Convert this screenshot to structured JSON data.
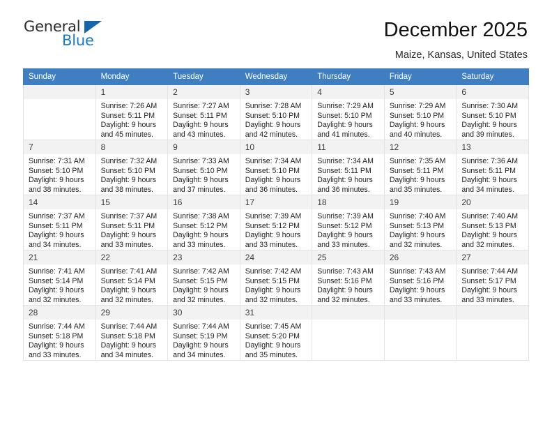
{
  "brand": {
    "name_part1": "General",
    "name_part2": "Blue",
    "triangle_color": "#1565ab",
    "blue_color": "#1878c8"
  },
  "header": {
    "title": "December 2025",
    "subtitle": "Maize, Kansas, United States"
  },
  "theme": {
    "header_row_bg": "#3f7fc1",
    "header_row_text": "#ffffff",
    "daynum_bg": "#f2f2f2",
    "cell_border": "#e3e3e3"
  },
  "weekdays": [
    "Sunday",
    "Monday",
    "Tuesday",
    "Wednesday",
    "Thursday",
    "Friday",
    "Saturday"
  ],
  "weeks": [
    [
      {
        "day": "",
        "empty": true,
        "sunrise": "",
        "sunset": "",
        "daylight_line1": "",
        "daylight_line2": ""
      },
      {
        "day": "1",
        "sunrise": "Sunrise: 7:26 AM",
        "sunset": "Sunset: 5:11 PM",
        "daylight_line1": "Daylight: 9 hours",
        "daylight_line2": "and 45 minutes."
      },
      {
        "day": "2",
        "sunrise": "Sunrise: 7:27 AM",
        "sunset": "Sunset: 5:11 PM",
        "daylight_line1": "Daylight: 9 hours",
        "daylight_line2": "and 43 minutes."
      },
      {
        "day": "3",
        "sunrise": "Sunrise: 7:28 AM",
        "sunset": "Sunset: 5:10 PM",
        "daylight_line1": "Daylight: 9 hours",
        "daylight_line2": "and 42 minutes."
      },
      {
        "day": "4",
        "sunrise": "Sunrise: 7:29 AM",
        "sunset": "Sunset: 5:10 PM",
        "daylight_line1": "Daylight: 9 hours",
        "daylight_line2": "and 41 minutes."
      },
      {
        "day": "5",
        "sunrise": "Sunrise: 7:29 AM",
        "sunset": "Sunset: 5:10 PM",
        "daylight_line1": "Daylight: 9 hours",
        "daylight_line2": "and 40 minutes."
      },
      {
        "day": "6",
        "sunrise": "Sunrise: 7:30 AM",
        "sunset": "Sunset: 5:10 PM",
        "daylight_line1": "Daylight: 9 hours",
        "daylight_line2": "and 39 minutes."
      }
    ],
    [
      {
        "day": "7",
        "sunrise": "Sunrise: 7:31 AM",
        "sunset": "Sunset: 5:10 PM",
        "daylight_line1": "Daylight: 9 hours",
        "daylight_line2": "and 38 minutes."
      },
      {
        "day": "8",
        "sunrise": "Sunrise: 7:32 AM",
        "sunset": "Sunset: 5:10 PM",
        "daylight_line1": "Daylight: 9 hours",
        "daylight_line2": "and 38 minutes."
      },
      {
        "day": "9",
        "sunrise": "Sunrise: 7:33 AM",
        "sunset": "Sunset: 5:10 PM",
        "daylight_line1": "Daylight: 9 hours",
        "daylight_line2": "and 37 minutes."
      },
      {
        "day": "10",
        "sunrise": "Sunrise: 7:34 AM",
        "sunset": "Sunset: 5:10 PM",
        "daylight_line1": "Daylight: 9 hours",
        "daylight_line2": "and 36 minutes."
      },
      {
        "day": "11",
        "sunrise": "Sunrise: 7:34 AM",
        "sunset": "Sunset: 5:11 PM",
        "daylight_line1": "Daylight: 9 hours",
        "daylight_line2": "and 36 minutes."
      },
      {
        "day": "12",
        "sunrise": "Sunrise: 7:35 AM",
        "sunset": "Sunset: 5:11 PM",
        "daylight_line1": "Daylight: 9 hours",
        "daylight_line2": "and 35 minutes."
      },
      {
        "day": "13",
        "sunrise": "Sunrise: 7:36 AM",
        "sunset": "Sunset: 5:11 PM",
        "daylight_line1": "Daylight: 9 hours",
        "daylight_line2": "and 34 minutes."
      }
    ],
    [
      {
        "day": "14",
        "sunrise": "Sunrise: 7:37 AM",
        "sunset": "Sunset: 5:11 PM",
        "daylight_line1": "Daylight: 9 hours",
        "daylight_line2": "and 34 minutes."
      },
      {
        "day": "15",
        "sunrise": "Sunrise: 7:37 AM",
        "sunset": "Sunset: 5:11 PM",
        "daylight_line1": "Daylight: 9 hours",
        "daylight_line2": "and 33 minutes."
      },
      {
        "day": "16",
        "sunrise": "Sunrise: 7:38 AM",
        "sunset": "Sunset: 5:12 PM",
        "daylight_line1": "Daylight: 9 hours",
        "daylight_line2": "and 33 minutes."
      },
      {
        "day": "17",
        "sunrise": "Sunrise: 7:39 AM",
        "sunset": "Sunset: 5:12 PM",
        "daylight_line1": "Daylight: 9 hours",
        "daylight_line2": "and 33 minutes."
      },
      {
        "day": "18",
        "sunrise": "Sunrise: 7:39 AM",
        "sunset": "Sunset: 5:12 PM",
        "daylight_line1": "Daylight: 9 hours",
        "daylight_line2": "and 33 minutes."
      },
      {
        "day": "19",
        "sunrise": "Sunrise: 7:40 AM",
        "sunset": "Sunset: 5:13 PM",
        "daylight_line1": "Daylight: 9 hours",
        "daylight_line2": "and 32 minutes."
      },
      {
        "day": "20",
        "sunrise": "Sunrise: 7:40 AM",
        "sunset": "Sunset: 5:13 PM",
        "daylight_line1": "Daylight: 9 hours",
        "daylight_line2": "and 32 minutes."
      }
    ],
    [
      {
        "day": "21",
        "sunrise": "Sunrise: 7:41 AM",
        "sunset": "Sunset: 5:14 PM",
        "daylight_line1": "Daylight: 9 hours",
        "daylight_line2": "and 32 minutes."
      },
      {
        "day": "22",
        "sunrise": "Sunrise: 7:41 AM",
        "sunset": "Sunset: 5:14 PM",
        "daylight_line1": "Daylight: 9 hours",
        "daylight_line2": "and 32 minutes."
      },
      {
        "day": "23",
        "sunrise": "Sunrise: 7:42 AM",
        "sunset": "Sunset: 5:15 PM",
        "daylight_line1": "Daylight: 9 hours",
        "daylight_line2": "and 32 minutes."
      },
      {
        "day": "24",
        "sunrise": "Sunrise: 7:42 AM",
        "sunset": "Sunset: 5:15 PM",
        "daylight_line1": "Daylight: 9 hours",
        "daylight_line2": "and 32 minutes."
      },
      {
        "day": "25",
        "sunrise": "Sunrise: 7:43 AM",
        "sunset": "Sunset: 5:16 PM",
        "daylight_line1": "Daylight: 9 hours",
        "daylight_line2": "and 32 minutes."
      },
      {
        "day": "26",
        "sunrise": "Sunrise: 7:43 AM",
        "sunset": "Sunset: 5:16 PM",
        "daylight_line1": "Daylight: 9 hours",
        "daylight_line2": "and 33 minutes."
      },
      {
        "day": "27",
        "sunrise": "Sunrise: 7:44 AM",
        "sunset": "Sunset: 5:17 PM",
        "daylight_line1": "Daylight: 9 hours",
        "daylight_line2": "and 33 minutes."
      }
    ],
    [
      {
        "day": "28",
        "sunrise": "Sunrise: 7:44 AM",
        "sunset": "Sunset: 5:18 PM",
        "daylight_line1": "Daylight: 9 hours",
        "daylight_line2": "and 33 minutes."
      },
      {
        "day": "29",
        "sunrise": "Sunrise: 7:44 AM",
        "sunset": "Sunset: 5:18 PM",
        "daylight_line1": "Daylight: 9 hours",
        "daylight_line2": "and 34 minutes."
      },
      {
        "day": "30",
        "sunrise": "Sunrise: 7:44 AM",
        "sunset": "Sunset: 5:19 PM",
        "daylight_line1": "Daylight: 9 hours",
        "daylight_line2": "and 34 minutes."
      },
      {
        "day": "31",
        "sunrise": "Sunrise: 7:45 AM",
        "sunset": "Sunset: 5:20 PM",
        "daylight_line1": "Daylight: 9 hours",
        "daylight_line2": "and 35 minutes."
      },
      {
        "day": "",
        "empty": true,
        "sunrise": "",
        "sunset": "",
        "daylight_line1": "",
        "daylight_line2": ""
      },
      {
        "day": "",
        "empty": true,
        "sunrise": "",
        "sunset": "",
        "daylight_line1": "",
        "daylight_line2": ""
      },
      {
        "day": "",
        "empty": true,
        "sunrise": "",
        "sunset": "",
        "daylight_line1": "",
        "daylight_line2": ""
      }
    ]
  ]
}
